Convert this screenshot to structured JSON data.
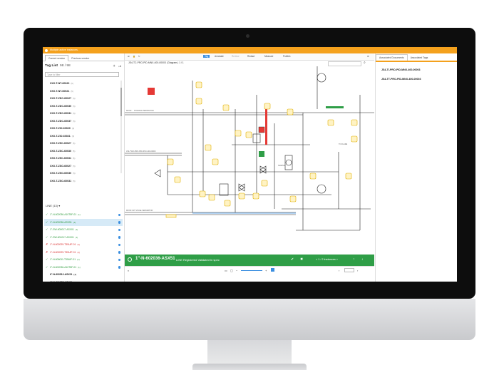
{
  "notice": {
    "text": "Multiple active instances."
  },
  "version_tabs": [
    "Current version",
    "Previous version"
  ],
  "tag_list": {
    "title": "Tag List",
    "count": "98 / 98",
    "filter_placeholder": "Type to filter",
    "items": [
      {
        "label": "XXX-T-NT-60020",
        "n": "(5)"
      },
      {
        "label": "XXX-T-NT-60021",
        "n": "(5)"
      },
      {
        "label": "XXX-T-ZDC-60027",
        "n": "(5)"
      },
      {
        "label": "XXX-T-ZDC-60030",
        "n": "(5)"
      },
      {
        "label": "XXX-T-ZDC-60031",
        "n": "(5)"
      },
      {
        "label": "XXX-T-ZDC-60037",
        "n": "(5)"
      },
      {
        "label": "XXX-T-ZIO-60020",
        "n": "(5)"
      },
      {
        "label": "XXX-T-ZIO-60021",
        "n": "(5)"
      },
      {
        "label": "XXX-T-ZSC-60027",
        "n": "(5)"
      },
      {
        "label": "XXX-T-ZSC-60030",
        "n": "(5)"
      },
      {
        "label": "XXX-T-ZSC-60031",
        "n": "(5)"
      },
      {
        "label": "XXX-T-ZSO-60027",
        "n": "(5)"
      },
      {
        "label": "XXX-T-ZSO-60030",
        "n": "(5)"
      },
      {
        "label": "XXX-T-ZSO-60031",
        "n": "(5)"
      }
    ]
  },
  "line_list": {
    "title": "LINE (13)",
    "items": [
      {
        "label": "1\"-N-602036-A10T8F-01",
        "n": "(1)",
        "status": "ok"
      },
      {
        "label": "1\"-N-602036-ASX51",
        "n": "(2)",
        "status": "ok",
        "selected": true
      },
      {
        "label": "1\"-SW-600017-ASX01",
        "n": "(1)",
        "status": "ok"
      },
      {
        "label": "1\"-SW-601017-ASX01",
        "n": "(1)",
        "status": "ok"
      },
      {
        "label": "1\"-N-602029-T35UIF-01",
        "n": "(1)",
        "status": "err"
      },
      {
        "label": "1\"-N-602029-T35UIF-01",
        "n": "(1)",
        "status": "err"
      },
      {
        "label": "1\"-N-606011-T35UIF-01",
        "n": "(1)",
        "status": "ok"
      },
      {
        "label": "2\"-N-602036-A10T8F-01",
        "n": "(1)",
        "status": "ok"
      },
      {
        "label": "6\"-N-600512-ASX01",
        "n": "(1)",
        "status": "plain"
      },
      {
        "label": "6\"-N-601558-ASX01",
        "n": "(1)",
        "status": "plain"
      }
    ]
  },
  "toolbar": {
    "items": [
      "Tag",
      "Annotate",
      "Review",
      "Redact",
      "Measure",
      "Publish"
    ],
    "active": "Tag"
  },
  "diagram_title": "JS4-TC-PRO-PID-MNX-400-00003 | Diagram | 1 / 1",
  "selection": {
    "tag": "1\"-N-602036-ASX51",
    "meta": "LINE   Registered   Validated   In spec",
    "instances": "< 1 / 2 instances >"
  },
  "right_panel": {
    "tabs": [
      "Associated Documents",
      "Associated Tags"
    ],
    "docs": [
      "JS4-TI-PRO-PID-MNX-400-00003",
      "JS4-TT-PRO-PID-MNX-400-00003"
    ]
  },
  "colors": {
    "accent": "#f4a11d",
    "selection_bar": "#2f9e47",
    "ok": "#2e9b3d",
    "error": "#d92b2b",
    "selected_row": "#d6eaf7"
  }
}
